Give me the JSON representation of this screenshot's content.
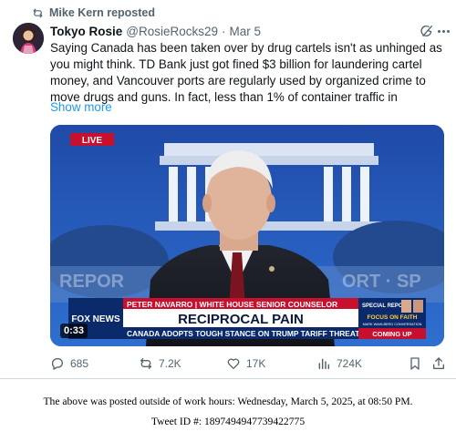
{
  "repost": {
    "label": "Mike Kern reposted",
    "icon": "repost-icon"
  },
  "author": {
    "name": "Tokyo Rosie",
    "handle": "@RosieRocks29",
    "separator": "·",
    "date": "Mar 5"
  },
  "tweet": {
    "text": "Saying Canada has been taken over by drug cartels isn't as unhinged as you might think. TD Bank just got fined $3 billion for laundering cartel money, and Vancouver ports are regularly used by organized crime to move drugs and guns. In fact, less than 1% of container traffic in",
    "show_more": "Show more"
  },
  "video": {
    "duration": "0:33",
    "live_badge": "LIVE",
    "network": "FOX NEWS",
    "lower_third_name": "PETER NAVARRO | WHITE HOUSE SENIOR COUNSELOR",
    "headline": "RECIPROCAL PAIN",
    "subheadline": "CANADA ADOPTS TOUGH STANCE ON TRUMP TARIFF THREATS",
    "promo_top": "SPECIAL REPORT",
    "promo_title": "FOCUS ON FAITH",
    "promo_sub": "MARK WAHLBERG CONVERSATION",
    "promo_bottom": "COMING UP",
    "background_text_left": "REPOR",
    "background_text_right": "ORT · SP"
  },
  "actions": {
    "replies": "685",
    "reposts": "7.2K",
    "likes": "17K",
    "views": "724K"
  },
  "footer": {
    "line1": "The above was posted outside of work hours: Wednesday, March 5, 2025, at 08:50 PM.",
    "line2": "Tweet ID #: 1897494947739422775"
  },
  "colors": {
    "link": "#1d9bf0",
    "secondary": "#536471",
    "fox_red": "#c8102e",
    "fox_blue": "#0b2a6b"
  }
}
